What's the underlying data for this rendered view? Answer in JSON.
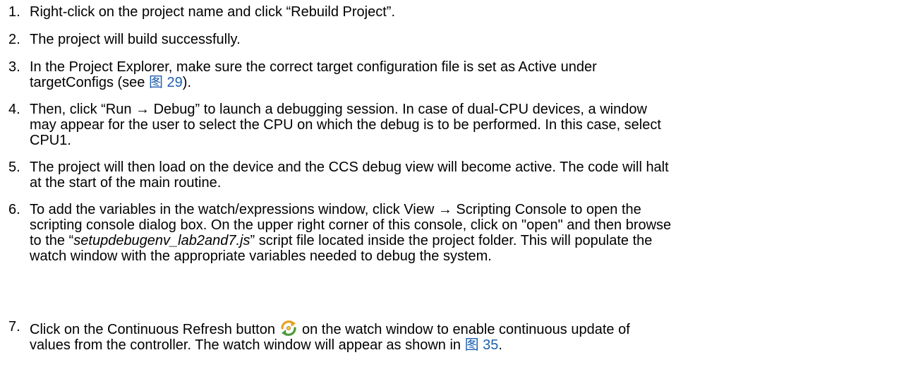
{
  "steps": [
    {
      "num": "1.",
      "lines": [
        "Right-click on the project name and click “Rebuild Project”."
      ]
    },
    {
      "num": "2.",
      "lines": [
        "The project will build successfully."
      ]
    },
    {
      "num": "3.",
      "line1": "In the Project Explorer, make sure the correct target configuration file is set as Active under",
      "line2_pre": "targetConfigs (see ",
      "line2_link": "图 29",
      "line2_post": ")."
    },
    {
      "num": "4.",
      "lines": [
        "Then, click “Run → Debug” to launch a debugging session. In case of dual-CPU devices, a window",
        "may appear for the user to select the CPU on which the debug is to be performed. In this case, select",
        "CPU1."
      ]
    },
    {
      "num": "5.",
      "lines": [
        "The project will then load on the device and the CCS debug view will become active. The code will halt",
        "at the start of the main routine."
      ]
    },
    {
      "num": "6.",
      "line1": "To add the variables in the watch/expressions window, click View → Scripting Console to open the",
      "line2": "scripting console dialog box. On the upper right corner of this console, click on \"open\" and then browse",
      "line3_pre": "to the “",
      "line3_em": "setupdebugenv_lab2and7.js",
      "line3_post": "” script file located inside the project folder. This will populate the",
      "line4": "watch window with the appropriate variables needed to debug the system."
    },
    {
      "num": "7.",
      "line1_pre": "Click on the Continuous Refresh button",
      "line1_post": "on the watch window to enable continuous update of",
      "icon": "continuous-refresh-icon",
      "line2_pre": "values from the controller. The watch window will appear as shown in ",
      "line2_link": "图 35",
      "line2_post": "."
    }
  ],
  "colors": {
    "text": "#000000",
    "link": "#1f5fb0",
    "icon_orange": "#e8a020",
    "icon_green": "#4a9a3a"
  }
}
